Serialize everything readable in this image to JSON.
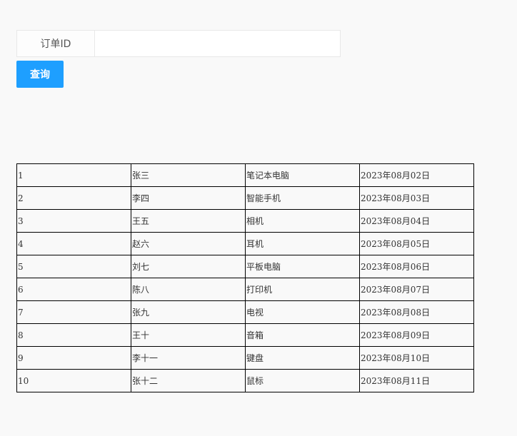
{
  "search": {
    "label": "订单ID",
    "value": "",
    "placeholder": "",
    "button_label": "查询"
  },
  "orders": {
    "rows": [
      {
        "id": "1",
        "name": "张三",
        "product": "笔记本电脑",
        "date": "2023年08月02日"
      },
      {
        "id": "2",
        "name": "李四",
        "product": "智能手机",
        "date": "2023年08月03日"
      },
      {
        "id": "3",
        "name": "王五",
        "product": "相机",
        "date": "2023年08月04日"
      },
      {
        "id": "4",
        "name": "赵六",
        "product": "耳机",
        "date": "2023年08月05日"
      },
      {
        "id": "5",
        "name": "刘七",
        "product": "平板电脑",
        "date": "2023年08月06日"
      },
      {
        "id": "6",
        "name": "陈八",
        "product": "打印机",
        "date": "2023年08月07日"
      },
      {
        "id": "7",
        "name": "张九",
        "product": "电视",
        "date": "2023年08月08日"
      },
      {
        "id": "8",
        "name": "王十",
        "product": "音箱",
        "date": "2023年08月09日"
      },
      {
        "id": "9",
        "name": "李十一",
        "product": "键盘",
        "date": "2023年08月10日"
      },
      {
        "id": "10",
        "name": "张十二",
        "product": "鼠标",
        "date": "2023年08月11日"
      }
    ]
  }
}
